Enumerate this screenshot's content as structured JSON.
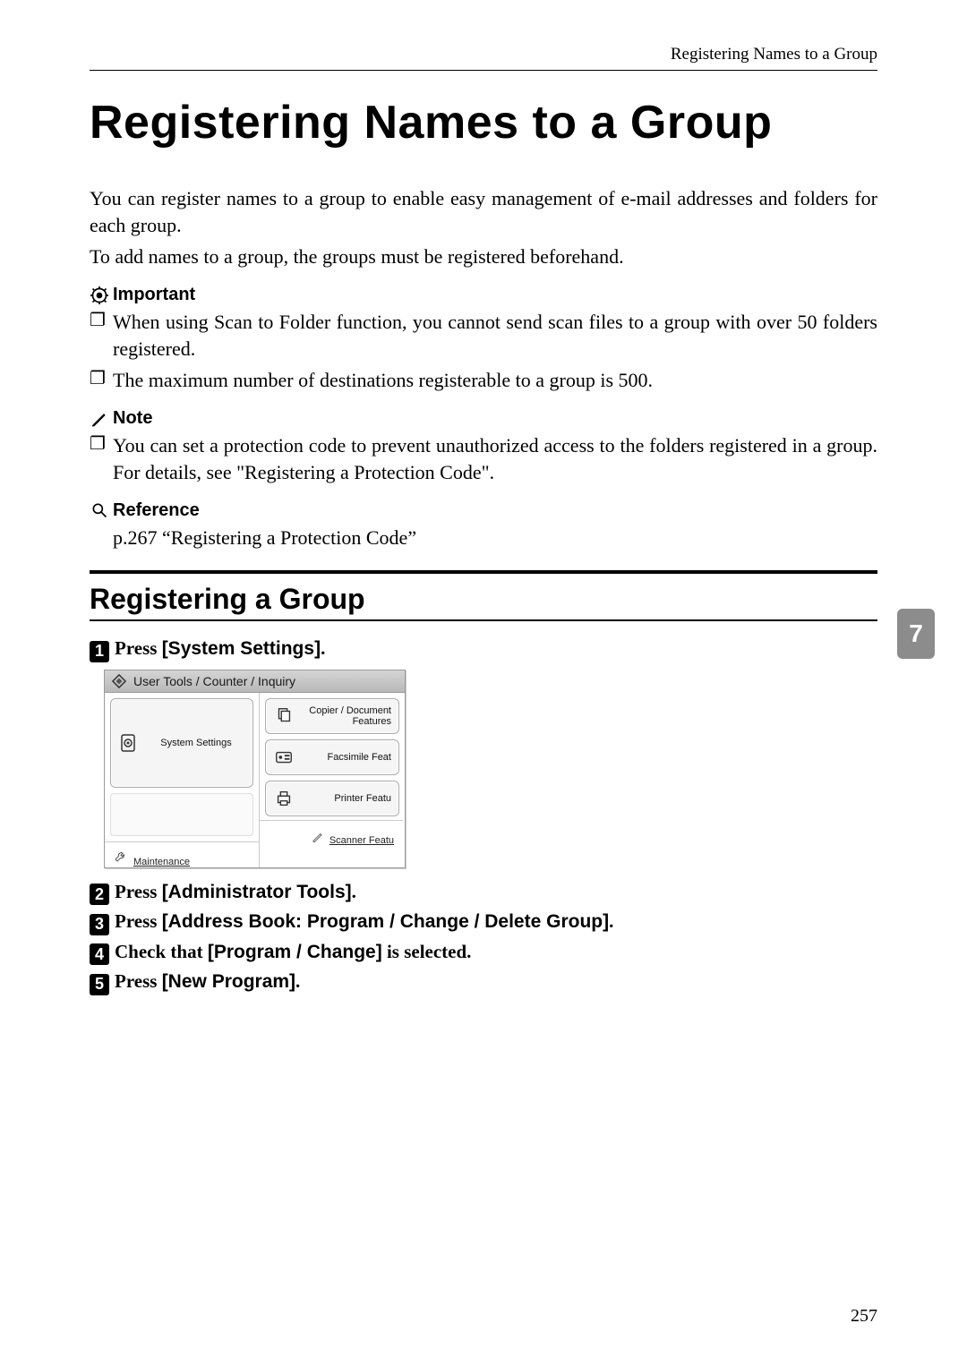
{
  "header": {
    "running_head": "Registering Names to a Group"
  },
  "title": "Registering Names to a Group",
  "intro": {
    "p1": "You can register names to a group to enable easy management of e-mail addresses and folders for each group.",
    "p2": "To add names to a group, the groups must be registered beforehand."
  },
  "important": {
    "label": "Important",
    "items": [
      "When using Scan to Folder function, you cannot send scan files to a group with over 50 folders registered.",
      "The maximum number of destinations registerable to a group is 500."
    ]
  },
  "note": {
    "label": "Note",
    "items": [
      "You can set a protection code to prevent unauthorized access to the folders registered in a group. For details, see \"Registering a Protection Code\"."
    ]
  },
  "reference": {
    "label": "Reference",
    "body": "p.267 “Registering a Protection Code”"
  },
  "subhead": "Registering a Group",
  "steps": [
    {
      "num": "1",
      "prefix": "Press ",
      "bold_sans": "[System Settings]",
      "suffix": "."
    },
    {
      "num": "2",
      "prefix": "Press ",
      "bold_sans": "[Administrator Tools]",
      "suffix": "."
    },
    {
      "num": "3",
      "prefix": "Press ",
      "bold_sans": "[Address Book: Program / Change / Delete Group]",
      "suffix": "."
    },
    {
      "num": "4",
      "prefix": "Check that ",
      "bold_sans": "[Program / Change]",
      "suffix": " is selected."
    },
    {
      "num": "5",
      "prefix": "Press ",
      "bold_sans": "[New Program]",
      "suffix": "."
    }
  ],
  "ui": {
    "title": "User Tools / Counter / Inquiry",
    "system_settings": "System Settings",
    "maintenance": "Maintenance",
    "copier": "Copier / Document\nFeatures",
    "fax": "Facsimile Feat",
    "printer": "Printer Featu",
    "scanner": "Scanner Featu"
  },
  "side_tab": "7",
  "page_number": "257",
  "icons": {
    "important": "important-icon",
    "note": "note-icon",
    "reference": "reference-icon",
    "diamond": "diamond-icon",
    "gear_doc": "settings-doc-icon",
    "copier": "copier-icon",
    "fax": "fax-icon",
    "printer": "printer-icon",
    "scanner": "scanner-pen-icon",
    "wrench": "wrench-icon"
  }
}
